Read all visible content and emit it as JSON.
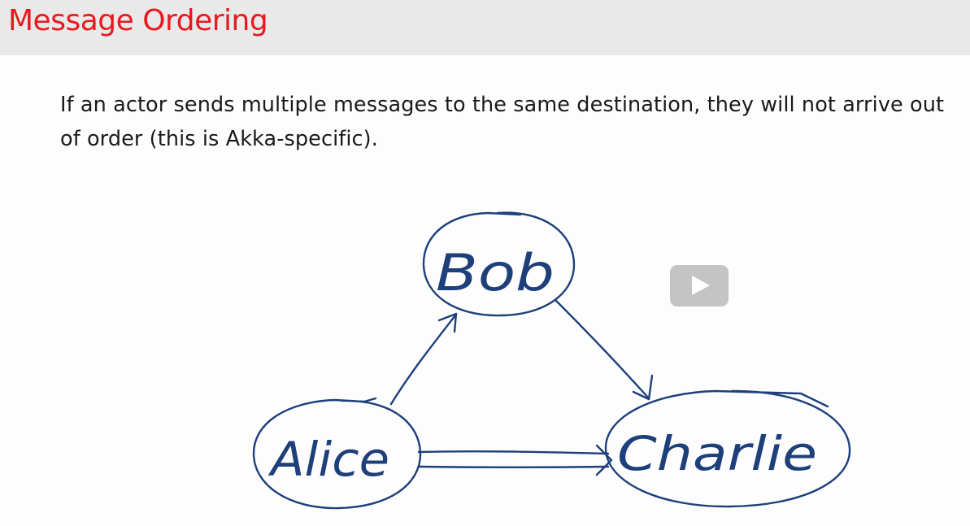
{
  "slide": {
    "title": "Message Ordering",
    "body": "If an actor sends multiple messages to the same destination, they will not arrive out of order (this is Akka-specific)."
  },
  "diagram": {
    "nodes": [
      {
        "id": "bob",
        "label": "Bob"
      },
      {
        "id": "alice",
        "label": "Alice"
      },
      {
        "id": "charlie",
        "label": "Charlie"
      }
    ],
    "edges": [
      {
        "from": "alice",
        "to": "bob"
      },
      {
        "from": "bob",
        "to": "charlie"
      },
      {
        "from": "alice",
        "to": "charlie",
        "style": "double"
      }
    ],
    "ink_color": "#1d3f7a"
  },
  "video_overlay": {
    "icon": "play-icon"
  },
  "colors": {
    "title": "#e8191f",
    "header_background": "#e9e9e9",
    "text": "#1a1a1a"
  }
}
